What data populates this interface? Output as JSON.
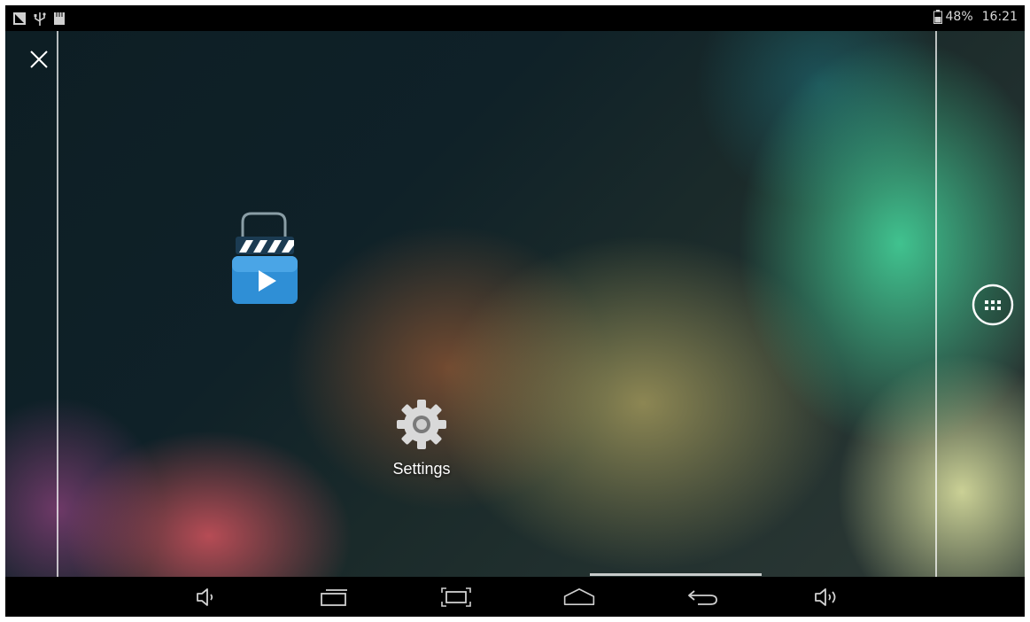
{
  "status_bar": {
    "left_icons": [
      "screenshot-notification-icon",
      "usb-icon",
      "sd-card-icon"
    ],
    "battery_icon": "battery-icon",
    "battery_percent": "48%",
    "time": "16:21"
  },
  "home_screen": {
    "close_icon": "close-icon",
    "shortcuts": [
      {
        "icon": "video-player-icon",
        "label": ""
      },
      {
        "icon": "gear-icon",
        "label": "Settings"
      }
    ],
    "all_apps_icon": "app-drawer-icon"
  },
  "nav_bar": {
    "buttons": [
      "volume-down-icon",
      "recent-apps-icon",
      "screenshot-icon",
      "home-icon",
      "back-icon",
      "volume-up-icon"
    ]
  },
  "colors": {
    "icon_blue": "#2f8fd6",
    "bar_background": "#000000",
    "text": "#ffffff"
  }
}
